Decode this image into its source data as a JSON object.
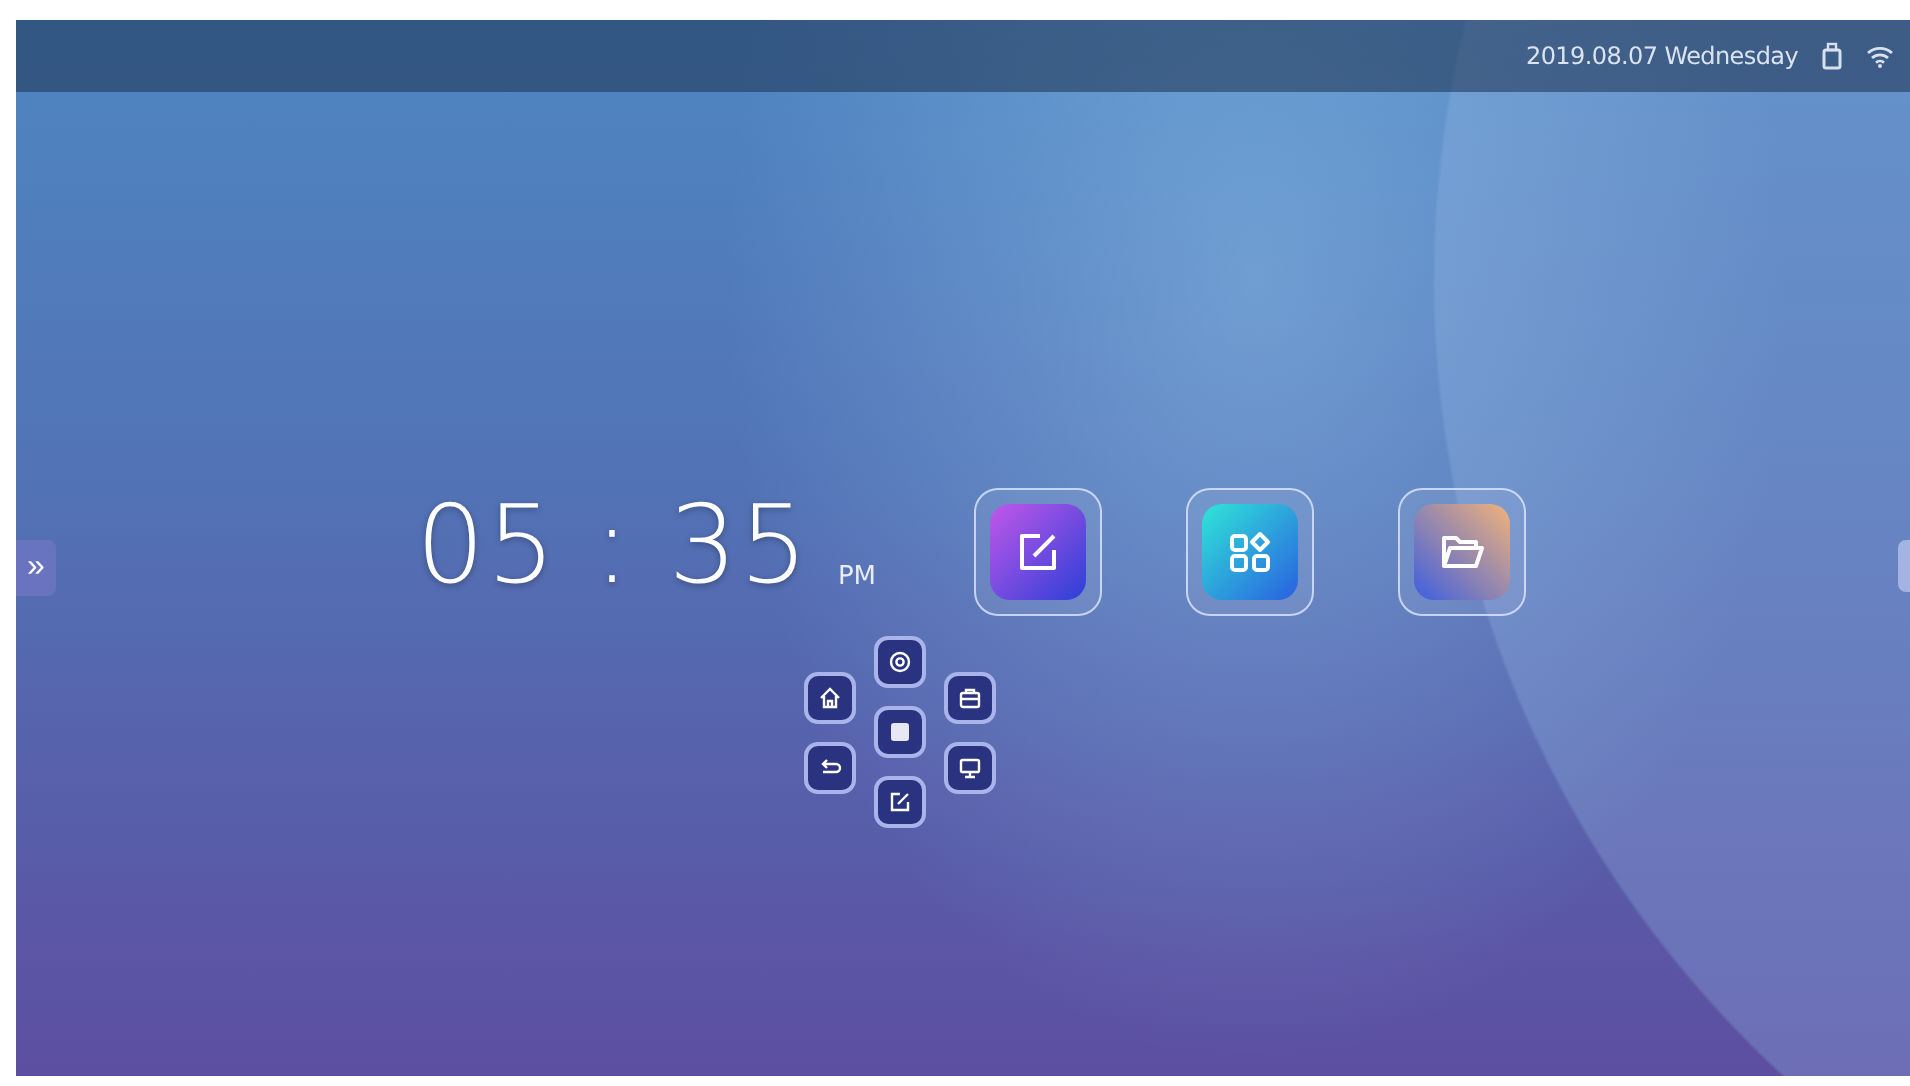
{
  "status_bar": {
    "date": "2019.08.07 Wednesday"
  },
  "left_tab": {
    "label": "»"
  },
  "clock": {
    "time": "05 : 35",
    "period": "PM"
  },
  "apps": [
    {
      "kind": "note"
    },
    {
      "kind": "apps"
    },
    {
      "kind": "folder"
    }
  ],
  "quick_panel": [
    {
      "kind": "settings"
    },
    {
      "kind": "home"
    },
    {
      "kind": "toolbox"
    },
    {
      "kind": "stop"
    },
    {
      "kind": "back"
    },
    {
      "kind": "monitor"
    },
    {
      "kind": "annotate"
    }
  ]
}
